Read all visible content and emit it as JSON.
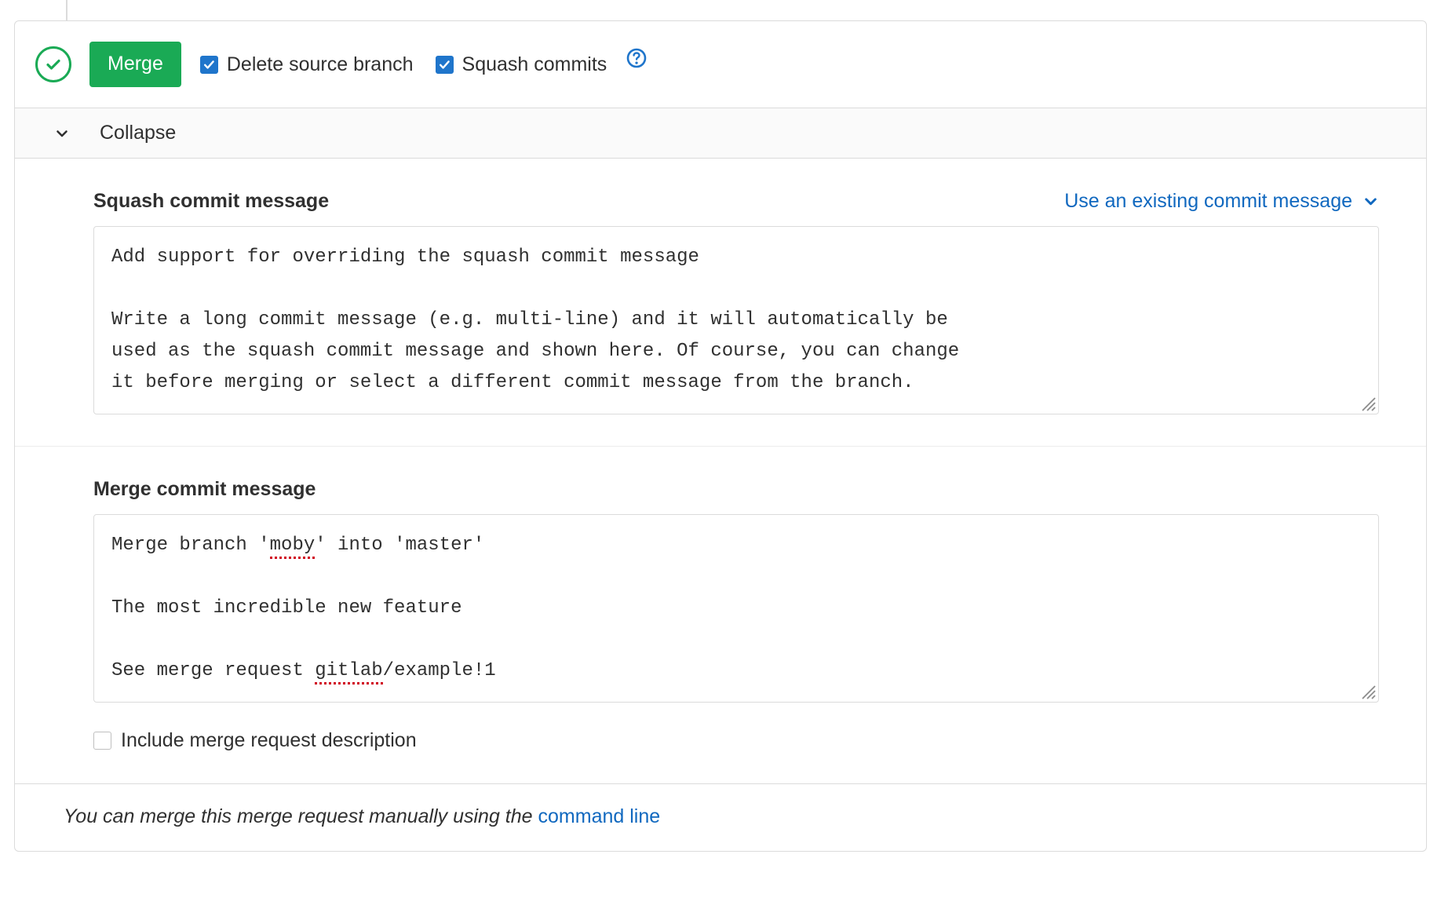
{
  "colors": {
    "success_green": "#1aaa55",
    "link_blue": "#1068bf",
    "checkbox_blue": "#1f75cb",
    "border_gray": "#dbdbdb",
    "bar_background": "#fafafa",
    "spellcheck_red": "#d0021b",
    "text": "#303030"
  },
  "header": {
    "status_icon": "check-circle-icon",
    "merge_button_label": "Merge",
    "checkboxes": [
      {
        "label": "Delete source branch",
        "checked": true,
        "name": "delete-source-branch"
      },
      {
        "label": "Squash commits",
        "checked": true,
        "name": "squash-commits"
      }
    ],
    "help_icon": "question-circle-icon"
  },
  "collapse": {
    "label": "Collapse",
    "icon": "chevron-down-icon",
    "expanded": true
  },
  "squash_section": {
    "label": "Squash commit message",
    "existing_link_label": "Use an existing commit message",
    "existing_link_icon": "chevron-down-icon",
    "message_lines": [
      "Add support for overriding the squash commit message",
      "",
      "Write a long commit message (e.g. multi-line) and it will automatically be",
      "used as the squash commit message and shown here. Of course, you can change",
      "it before merging or select a different commit message from the branch."
    ],
    "resize_handle": "resize-grip-icon"
  },
  "merge_section": {
    "label": "Merge commit message",
    "message_lines": [
      {
        "prefix": "Merge branch '",
        "misspelled": "moby",
        "suffix": "' into 'master'"
      },
      {
        "prefix": "",
        "misspelled": "",
        "suffix": ""
      },
      {
        "prefix": "The most incredible new feature",
        "misspelled": "",
        "suffix": ""
      },
      {
        "prefix": "",
        "misspelled": "",
        "suffix": ""
      },
      {
        "prefix": "See merge request ",
        "misspelled": "gitlab",
        "suffix": "/example!1"
      }
    ],
    "include_description": {
      "label": "Include merge request description",
      "checked": false
    },
    "resize_handle": "resize-grip-icon"
  },
  "footer": {
    "text_before": "You can merge this merge request manually using the ",
    "link_label": "command line"
  }
}
